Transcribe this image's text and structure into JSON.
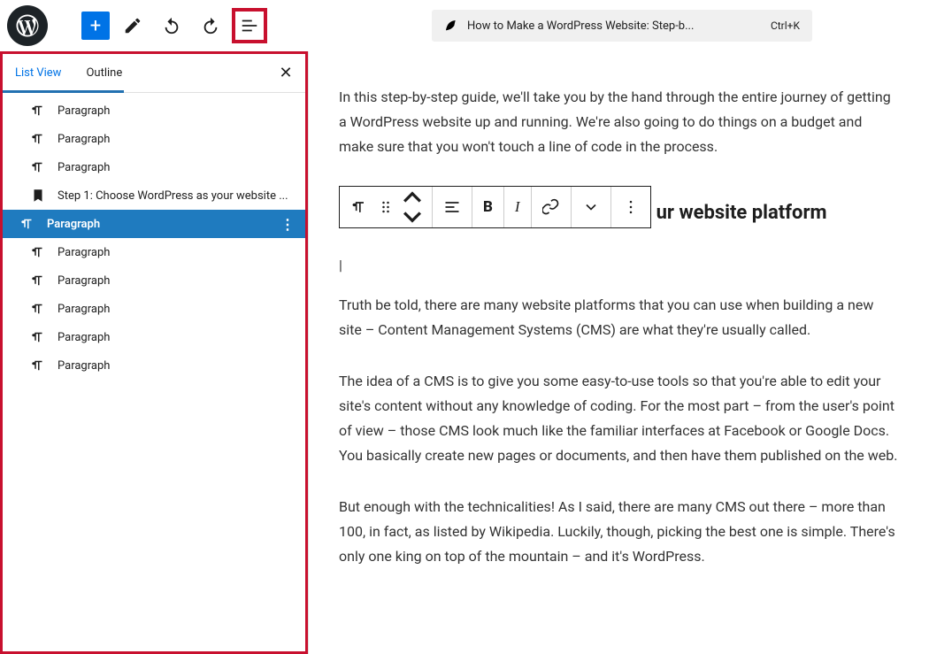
{
  "topbar": {
    "title": "How to Make a WordPress Website: Step-b...",
    "shortcut": "Ctrl+K"
  },
  "sidebar": {
    "tabs": {
      "list_view": "List View",
      "outline": "Outline"
    },
    "items": [
      {
        "icon": "paragraph",
        "label": "Paragraph",
        "selected": false
      },
      {
        "icon": "paragraph",
        "label": "Paragraph",
        "selected": false
      },
      {
        "icon": "paragraph",
        "label": "Paragraph",
        "selected": false
      },
      {
        "icon": "bookmark",
        "label": "Step 1: Choose WordPress as your website ...",
        "selected": false
      },
      {
        "icon": "paragraph",
        "label": "Paragraph",
        "selected": true
      },
      {
        "icon": "paragraph",
        "label": "Paragraph",
        "selected": false
      },
      {
        "icon": "paragraph",
        "label": "Paragraph",
        "selected": false
      },
      {
        "icon": "paragraph",
        "label": "Paragraph",
        "selected": false
      },
      {
        "icon": "paragraph",
        "label": "Paragraph",
        "selected": false
      },
      {
        "icon": "paragraph",
        "label": "Paragraph",
        "selected": false
      }
    ]
  },
  "content": {
    "p1": "In this step-by-step guide, we'll take you by the hand through the entire journey of getting a WordPress website up and running. We're also going to do things on a budget and make sure that you won't touch a line of code in the process.",
    "heading_fragment": "ur website platform",
    "p2": "Truth be told, there are many website platforms that you can use when building a new site – Content Management Systems (CMS) are what they're usually called.",
    "p3": "The idea of a CMS is to give you some easy-to-use tools so that you're able to edit your site's content without any knowledge of coding. For the most part – from the user's point of view – those CMS look much like the familiar interfaces at Facebook or Google Docs. You basically create new pages or documents, and then have them published on the web.",
    "p4": "But enough with the technicalities! As I said, there are many CMS out there – more than 100, in fact, as listed by Wikipedia. Luckily, though, picking the best one is simple. There's only one king on top of the mountain – and it's WordPress."
  }
}
